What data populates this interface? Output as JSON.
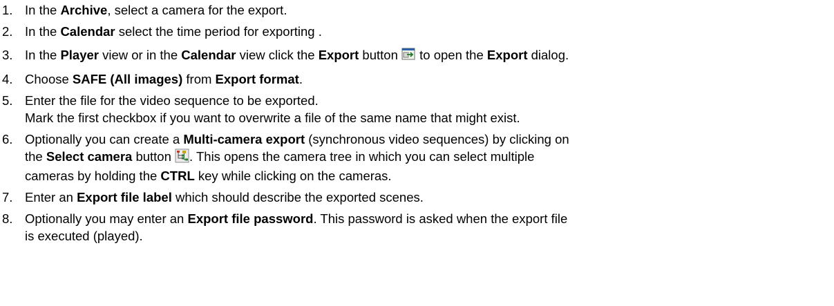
{
  "steps": [
    {
      "number": "1.",
      "lines": [
        {
          "t1": "In the ",
          "b1": "Archive",
          "t2": ", select a camera for the export."
        }
      ]
    },
    {
      "number": "2.",
      "lines": [
        {
          "t1": "In the ",
          "b1": "Calendar",
          "t2": " select the time period for exporting ."
        }
      ]
    },
    {
      "number": "3.",
      "lines": [
        {
          "t1": "In the ",
          "b1": "Player",
          "t2": " view or in the ",
          "b2": "Calendar",
          "t3": " view click the ",
          "b3": "Export",
          "t4": " button ",
          "icon": "export-icon",
          "t5": " to open the ",
          "b4": "Export",
          "t6": " dialog."
        }
      ]
    },
    {
      "number": "4.",
      "lines": [
        {
          "t1": "Choose ",
          "b1": "SAFE (All images)",
          "t2": " from ",
          "b2": "Export format",
          "t3": "."
        }
      ]
    },
    {
      "number": "5.",
      "lines": [
        {
          "t1": "Enter the file for the video sequence to be exported."
        },
        {
          "t1": "Mark the first checkbox if you want to overwrite a file of the same name that might exist."
        }
      ]
    },
    {
      "number": "6.",
      "lines": [
        {
          "t1": "Optionally you can create a ",
          "b1": "Multi-camera export",
          "t2": " (synchronous video sequences) by clicking on"
        },
        {
          "t1": "the ",
          "b1": "Select camera",
          "t2": " button ",
          "icon": "camera-tree-icon",
          "t3": ". This opens the camera tree in which you can select multiple"
        },
        {
          "t1": "cameras by holding the ",
          "b1": "CTRL",
          "t2": " key while clicking on the cameras."
        }
      ]
    },
    {
      "number": "7.",
      "lines": [
        {
          "t1": "Enter an ",
          "b1": "Export file label",
          "t2": " which should describe the exported scenes."
        }
      ]
    },
    {
      "number": "8.",
      "lines": [
        {
          "t1": "Optionally you may enter an ",
          "b1": "Export file password",
          "t2": ". This password is asked when the export file"
        },
        {
          "t1": "is executed (played)."
        }
      ]
    }
  ]
}
